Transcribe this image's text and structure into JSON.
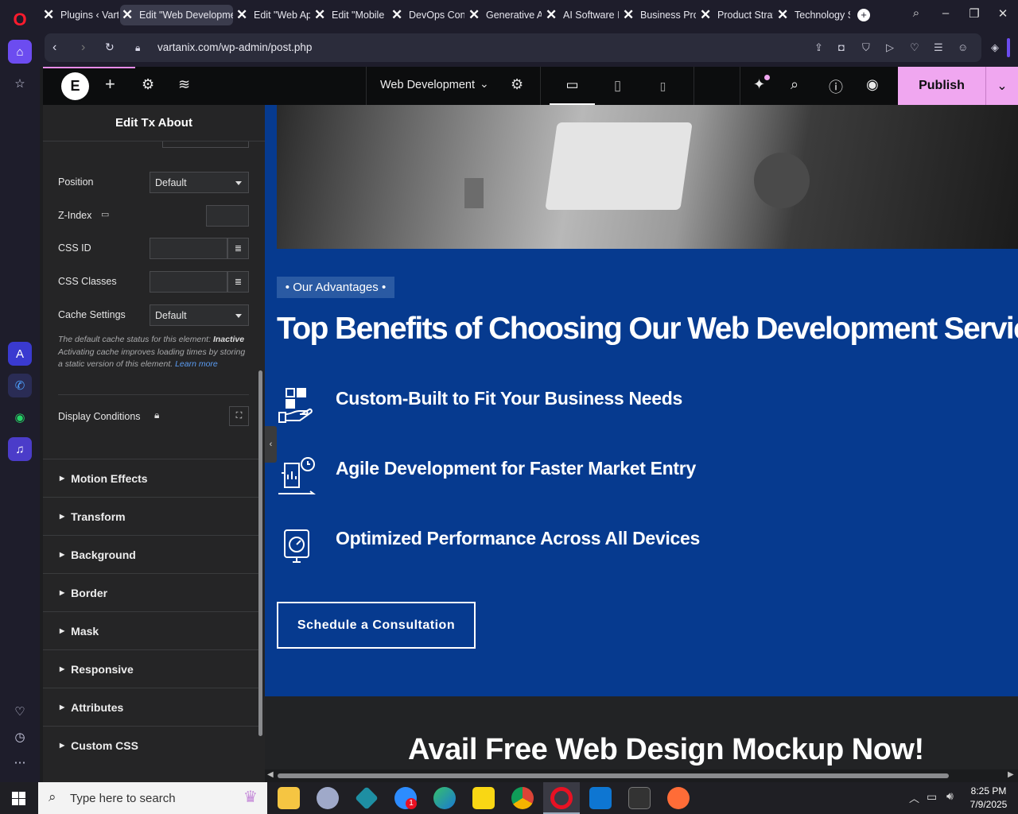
{
  "browser": {
    "tabs": [
      {
        "title": "Plugins ‹ Vart"
      },
      {
        "title": "Edit \"Web Developme",
        "active": true
      },
      {
        "title": "Edit \"Web Ap"
      },
      {
        "title": "Edit \"Mobile"
      },
      {
        "title": "DevOps Con"
      },
      {
        "title": "Generative A"
      },
      {
        "title": "AI Software I"
      },
      {
        "title": "Business Pro"
      },
      {
        "title": "Product Strat"
      },
      {
        "title": "Technology S"
      }
    ],
    "url": "vartanix.com/wp-admin/post.php"
  },
  "editor": {
    "page_name": "Web Development",
    "publish_label": "Publish",
    "panel_title": "Edit Tx About",
    "fields": {
      "position_label": "Position",
      "position_value": "Default",
      "zindex_label": "Z-Index",
      "cssid_label": "CSS ID",
      "cssclasses_label": "CSS Classes",
      "cache_label": "Cache Settings",
      "cache_value": "Default",
      "cache_note_prefix": "The default cache status for this element:",
      "cache_note_status": "Inactive",
      "cache_note_body": "Activating cache improves loading times by storing a static version of this element.",
      "cache_note_link": "Learn more",
      "display_conditions_label": "Display Conditions"
    },
    "sections": [
      "Motion Effects",
      "Transform",
      "Background",
      "Border",
      "Mask",
      "Responsive",
      "Attributes",
      "Custom CSS"
    ]
  },
  "canvas": {
    "badge": "• Our Advantages •",
    "heading": "Top Benefits of Choosing Our Web Development Services",
    "features": [
      "Custom-Built to Fit Your Business Needs",
      "Agile Development for Faster Market Entry",
      "Optimized Performance Across All Devices"
    ],
    "cta": "Schedule a Consultation",
    "heading2": "Avail Free Web Design Mockup Now!"
  },
  "taskbar": {
    "search_placeholder": "Type here to search",
    "time": "8:25 PM",
    "date": "7/9/2025",
    "zoom_badge": "1"
  },
  "colors": {
    "brand_blue": "#063a8f",
    "publish_pink": "#f0a7f0",
    "panel_dark": "#252526"
  }
}
